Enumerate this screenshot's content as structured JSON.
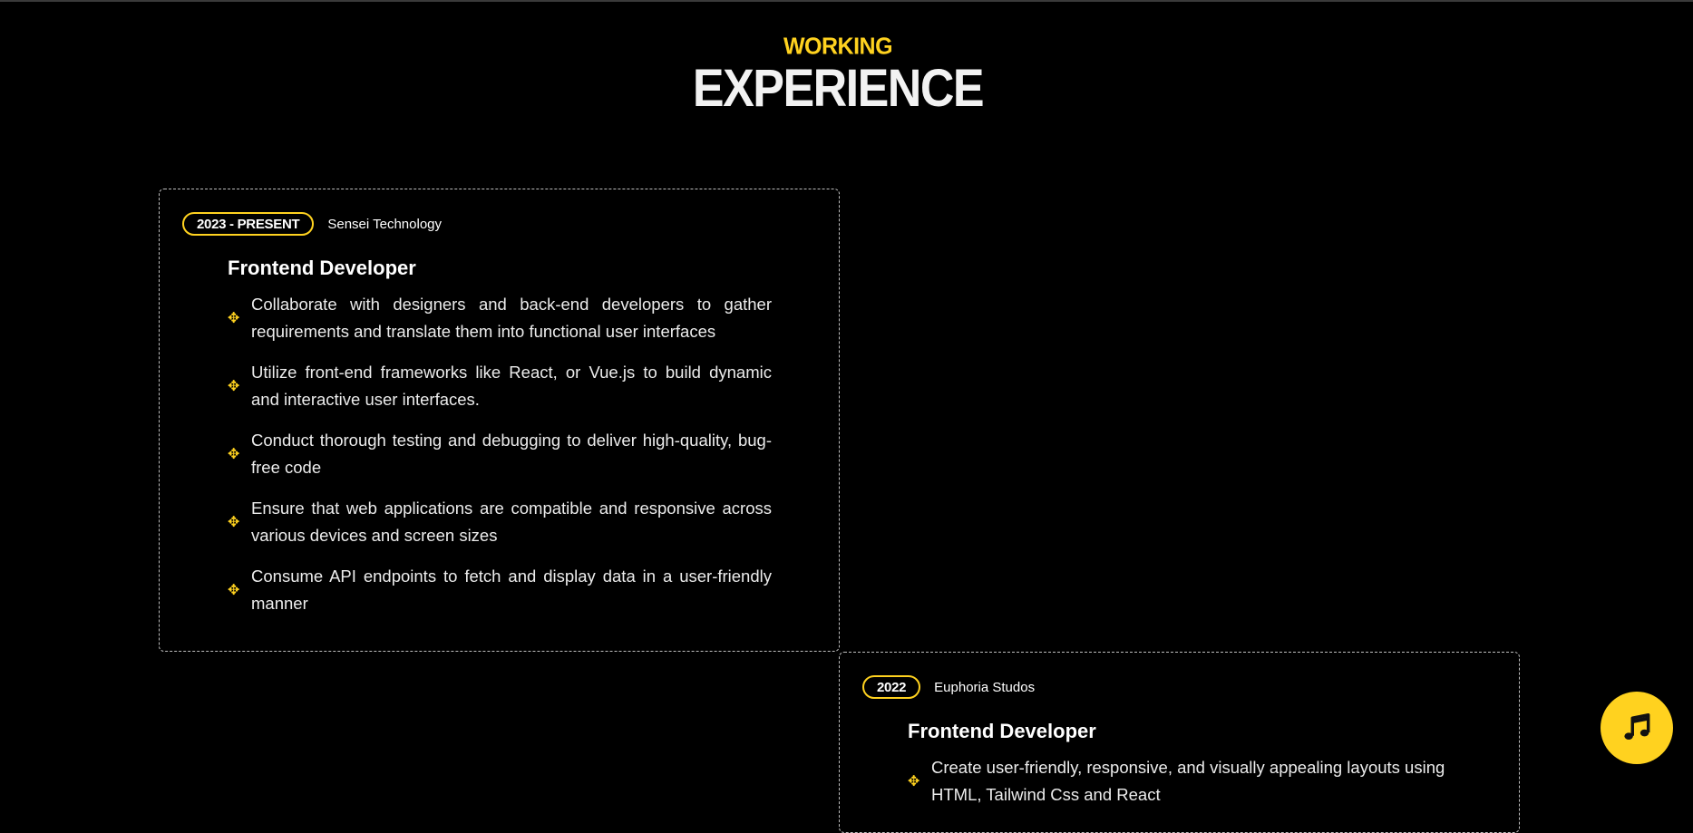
{
  "section": {
    "eyebrow": "WORKING",
    "title": "EXPERIENCE"
  },
  "colors": {
    "accent": "#ffd21f",
    "background": "#000000",
    "text": "#ffffff",
    "card_border": "#bdbdbd"
  },
  "experiences": [
    {
      "period": "2023 - PRESENT",
      "company": "Sensei Technology",
      "role": "Frontend Developer",
      "bullet_icon": "sparkle-icon",
      "duties": [
        "Collaborate with designers and back-end developers to gather requirements and translate them into functional user interfaces",
        "Utilize front-end frameworks like React, or Vue.js to build dynamic and interactive user interfaces.",
        "Conduct thorough testing and debugging to deliver high-quality, bug-free code",
        "Ensure that web applications are compatible and responsive across various devices and screen sizes",
        "Consume API endpoints to fetch and display data in a user-friendly manner"
      ]
    },
    {
      "period": "2022",
      "company": "Euphoria Studos",
      "role": "Frontend Developer",
      "bullet_icon": "sparkle-icon",
      "duties": [
        "Create user-friendly, responsive, and visually appealing layouts using HTML, Tailwind Css and React"
      ]
    }
  ],
  "music_button": {
    "icon": "music-note-icon"
  }
}
